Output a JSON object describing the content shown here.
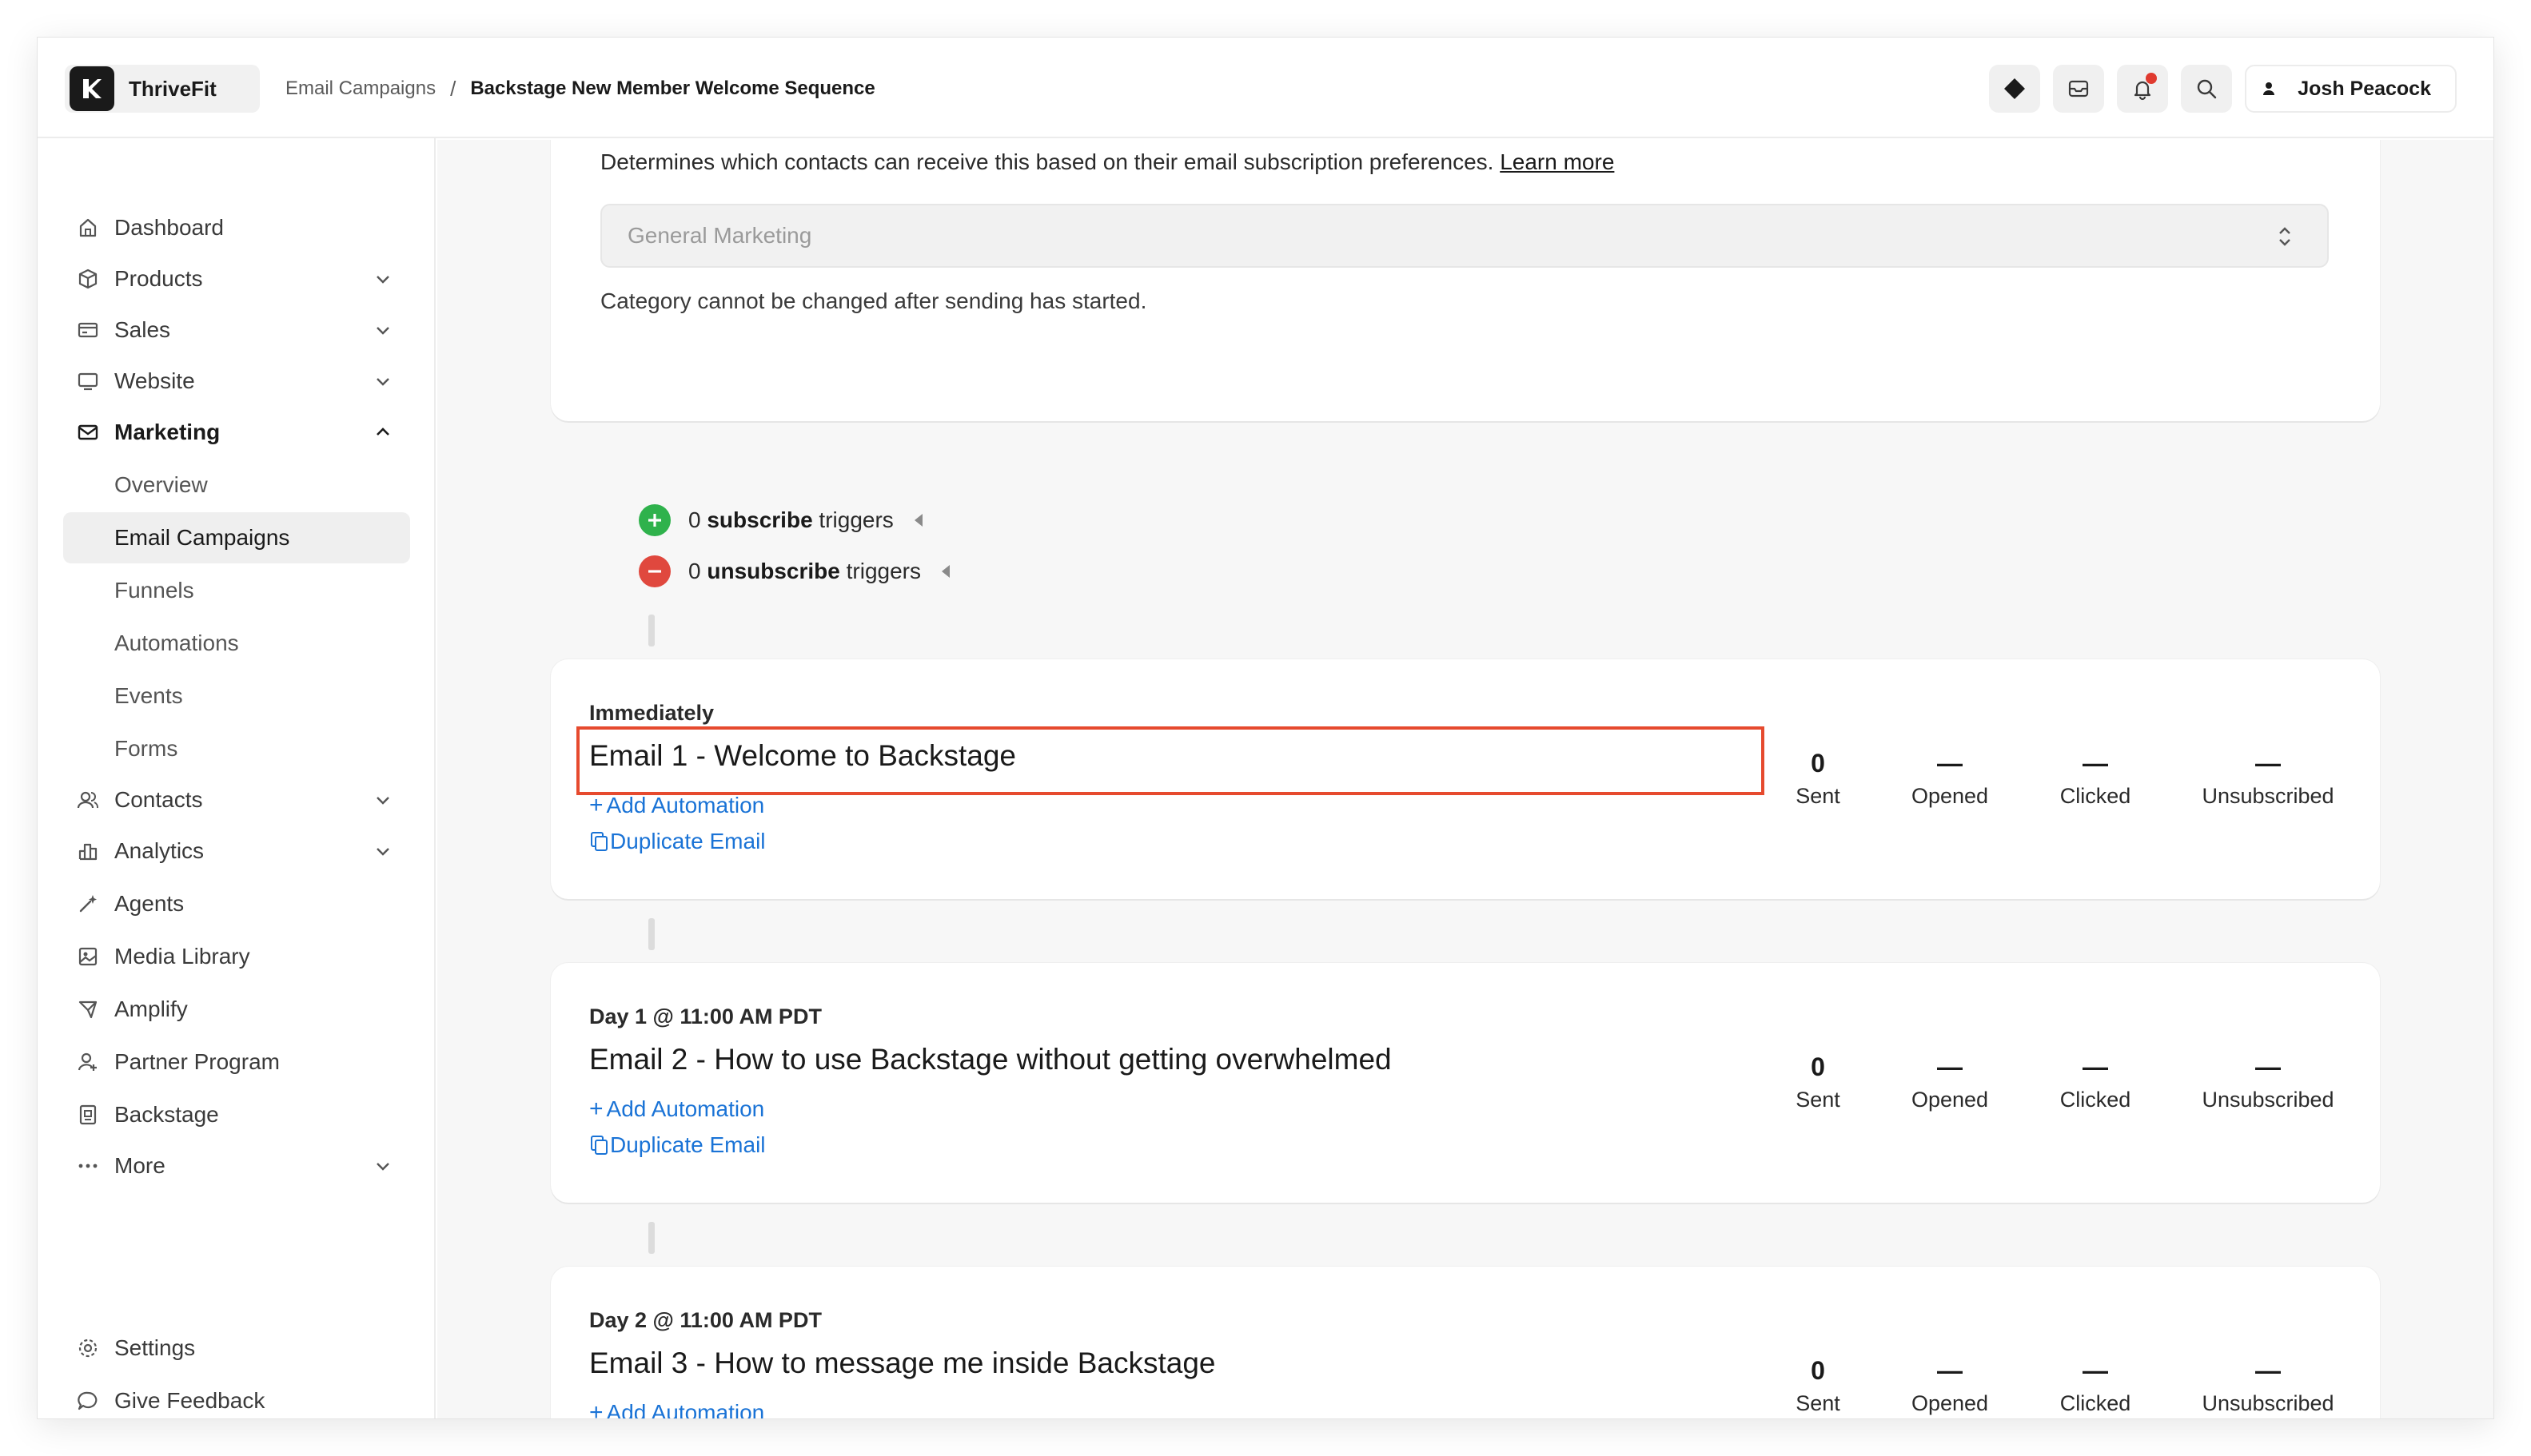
{
  "brand": {
    "name": "ThriveFit"
  },
  "breadcrumb": {
    "parent": "Email Campaigns",
    "separator": "/",
    "current": "Backstage New Member Welcome Sequence"
  },
  "user": {
    "name": "Josh Peacock"
  },
  "colors": {
    "accent": "#1a73d6",
    "highlight": "#e64a2e",
    "subscribe": "#2fb24c",
    "unsubscribe": "#e0483e",
    "notification": "#e03a2f"
  },
  "sidebar": {
    "items": [
      {
        "label": "Dashboard",
        "icon": "home-icon"
      },
      {
        "label": "Products",
        "icon": "box-icon"
      },
      {
        "label": "Sales",
        "icon": "card-icon"
      },
      {
        "label": "Website",
        "icon": "monitor-icon"
      },
      {
        "label": "Marketing",
        "icon": "mail-icon"
      },
      {
        "label": "Contacts",
        "icon": "users-icon"
      },
      {
        "label": "Analytics",
        "icon": "chart-icon"
      },
      {
        "label": "Agents",
        "icon": "sparkle-icon"
      },
      {
        "label": "Media Library",
        "icon": "image-icon"
      },
      {
        "label": "Amplify",
        "icon": "megaphone-icon"
      },
      {
        "label": "Partner Program",
        "icon": "partner-icon"
      },
      {
        "label": "Backstage",
        "icon": "backstage-icon"
      },
      {
        "label": "More",
        "icon": "dots-icon"
      }
    ],
    "marketing_sub": [
      {
        "label": "Overview"
      },
      {
        "label": "Email Campaigns"
      },
      {
        "label": "Funnels"
      },
      {
        "label": "Automations"
      },
      {
        "label": "Events"
      },
      {
        "label": "Forms"
      }
    ],
    "settings_label": "Settings",
    "feedback_label": "Give Feedback"
  },
  "category": {
    "description": "Determines which contacts can receive this based on their email subscription preferences.",
    "learn_more": "Learn more",
    "selected": "General Marketing",
    "note": "Category cannot be changed after sending has started."
  },
  "triggers": {
    "subscribe": {
      "count": "0",
      "bold": "subscribe",
      "suffix": "triggers"
    },
    "unsubscribe": {
      "count": "0",
      "bold": "unsubscribe",
      "suffix": "triggers"
    }
  },
  "email_actions": {
    "add_automation": "Add Automation",
    "duplicate": "Duplicate Email"
  },
  "stat_labels": {
    "sent": "Sent",
    "opened": "Opened",
    "clicked": "Clicked",
    "unsubscribed": "Unsubscribed"
  },
  "emails": [
    {
      "when": "Immediately",
      "title": "Email 1 - Welcome to Backstage",
      "sent": "0",
      "opened": "—",
      "clicked": "—",
      "unsubscribed": "—"
    },
    {
      "when": "Day 1 @ 11:00 AM PDT",
      "title": "Email 2 - How to use Backstage without getting overwhelmed",
      "sent": "0",
      "opened": "—",
      "clicked": "—",
      "unsubscribed": "—"
    },
    {
      "when": "Day 2 @ 11:00 AM PDT",
      "title": "Email 3 - How to message me inside Backstage",
      "sent": "0",
      "opened": "—",
      "clicked": "—",
      "unsubscribed": "—"
    }
  ]
}
